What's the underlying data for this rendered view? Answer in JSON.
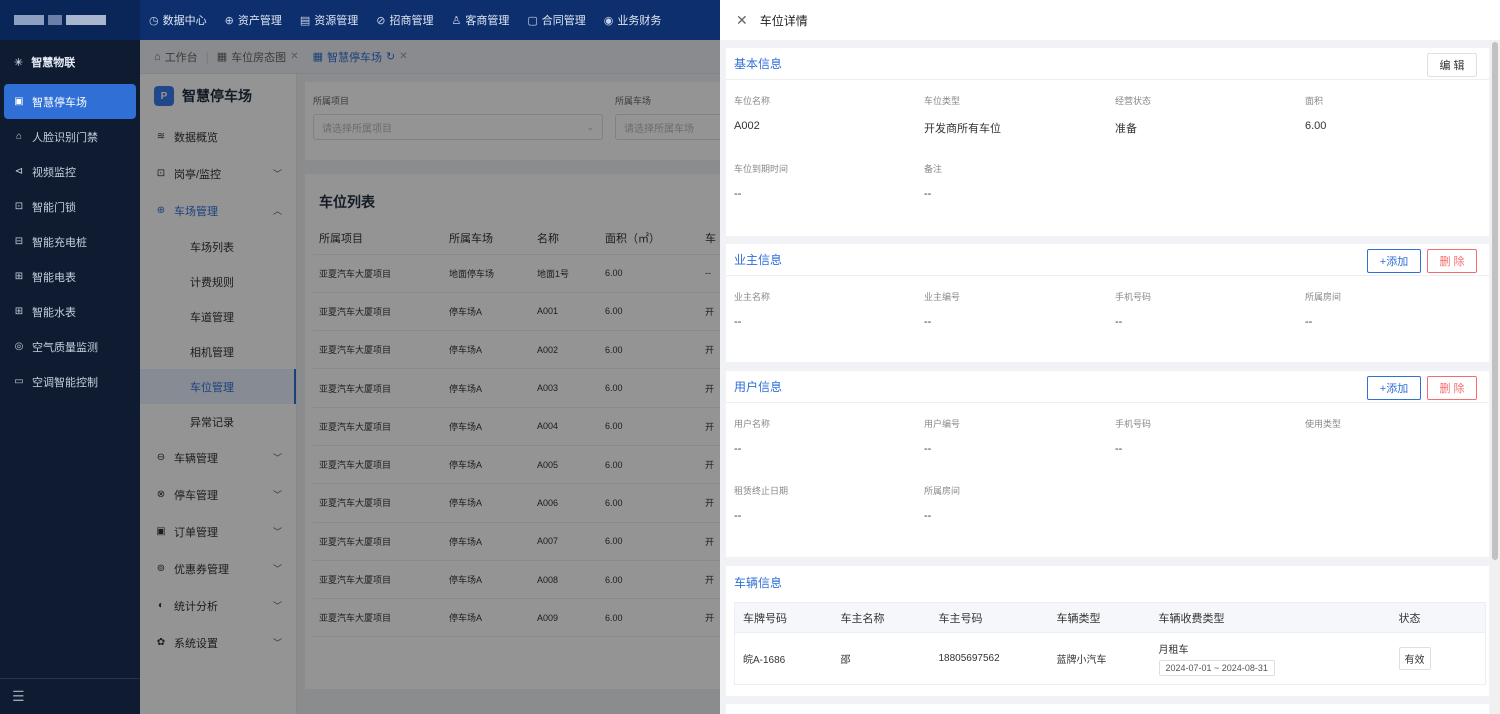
{
  "topnav": [
    {
      "icon": "◷",
      "label": "数据中心"
    },
    {
      "icon": "⊕",
      "label": "资产管理"
    },
    {
      "icon": "▤",
      "label": "资源管理"
    },
    {
      "icon": "⊘",
      "label": "招商管理"
    },
    {
      "icon": "♙",
      "label": "客商管理"
    },
    {
      "icon": "▢",
      "label": "合同管理"
    },
    {
      "icon": "◉",
      "label": "业务财务"
    }
  ],
  "sidebar": {
    "header": "智慧物联",
    "items": [
      {
        "label": "智慧停车场",
        "active": true
      },
      {
        "label": "人脸识别门禁"
      },
      {
        "label": "视频监控"
      },
      {
        "label": "智能门锁"
      },
      {
        "label": "智能充电桩"
      },
      {
        "label": "智能电表"
      },
      {
        "label": "智能水表"
      },
      {
        "label": "空气质量监测"
      },
      {
        "label": "空调智能控制"
      }
    ],
    "footer_icon": "☰"
  },
  "tabs": [
    {
      "label": "工作台"
    },
    {
      "label": "车位房态图"
    },
    {
      "label": "智慧停车场"
    }
  ],
  "submenu": {
    "title": "智慧停车场",
    "items": [
      {
        "label": "数据概览"
      },
      {
        "label": "岗亭/监控"
      },
      {
        "label": "车场管理"
      },
      {
        "label": "车辆管理"
      },
      {
        "label": "停车管理"
      },
      {
        "label": "订单管理"
      },
      {
        "label": "优惠券管理"
      },
      {
        "label": "统计分析"
      },
      {
        "label": "系统设置"
      }
    ],
    "subitems": [
      "车场列表",
      "计费规则",
      "车道管理",
      "相机管理",
      "车位管理",
      "异常记录"
    ]
  },
  "filters": {
    "project_label": "所属项目",
    "project_placeholder": "请选择所属项目",
    "lot_label": "所属车场",
    "lot_placeholder": "请选择所属车场"
  },
  "list": {
    "title": "车位列表",
    "columns": [
      "所属项目",
      "所属车场",
      "名称",
      "面积（㎡）",
      "车"
    ],
    "rows": [
      [
        "亚夏汽车大厦项目",
        "地面停车场",
        "地面1号",
        "6.00",
        "--"
      ],
      [
        "亚夏汽车大厦项目",
        "停车场A",
        "A001",
        "6.00",
        "开"
      ],
      [
        "亚夏汽车大厦项目",
        "停车场A",
        "A002",
        "6.00",
        "开"
      ],
      [
        "亚夏汽车大厦项目",
        "停车场A",
        "A003",
        "6.00",
        "开"
      ],
      [
        "亚夏汽车大厦项目",
        "停车场A",
        "A004",
        "6.00",
        "开"
      ],
      [
        "亚夏汽车大厦项目",
        "停车场A",
        "A005",
        "6.00",
        "开"
      ],
      [
        "亚夏汽车大厦项目",
        "停车场A",
        "A006",
        "6.00",
        "开"
      ],
      [
        "亚夏汽车大厦项目",
        "停车场A",
        "A007",
        "6.00",
        "开"
      ],
      [
        "亚夏汽车大厦项目",
        "停车场A",
        "A008",
        "6.00",
        "开"
      ],
      [
        "亚夏汽车大厦项目",
        "停车场A",
        "A009",
        "6.00",
        "开"
      ]
    ]
  },
  "drawer": {
    "title": "车位详情",
    "basic": {
      "title": "基本信息",
      "edit_label": "编 辑",
      "fields": [
        {
          "label": "车位名称",
          "value": "A002"
        },
        {
          "label": "车位类型",
          "value": "开发商所有车位"
        },
        {
          "label": "经营状态",
          "value": "准备"
        },
        {
          "label": "面积",
          "value": "6.00"
        },
        {
          "label": "车位到期时间",
          "value": "--"
        },
        {
          "label": "备注",
          "value": "--"
        }
      ]
    },
    "owner": {
      "title": "业主信息",
      "add_label": "+添加",
      "delete_label": "删 除",
      "fields": [
        {
          "label": "业主名称",
          "value": "--"
        },
        {
          "label": "业主编号",
          "value": "--"
        },
        {
          "label": "手机号码",
          "value": "--"
        },
        {
          "label": "所属房间",
          "value": "--"
        }
      ]
    },
    "user": {
      "title": "用户信息",
      "add_label": "+添加",
      "delete_label": "删 除",
      "fields": [
        {
          "label": "用户名称",
          "value": "--"
        },
        {
          "label": "用户编号",
          "value": "--"
        },
        {
          "label": "手机号码",
          "value": "--"
        },
        {
          "label": "使用类型",
          "value": ""
        },
        {
          "label": "租赁终止日期",
          "value": "--"
        },
        {
          "label": "所属房间",
          "value": "--"
        }
      ]
    },
    "vehicle": {
      "title": "车辆信息",
      "columns": [
        "车牌号码",
        "车主名称",
        "车主号码",
        "车辆类型",
        "车辆收费类型",
        "状态"
      ],
      "rows": [
        {
          "plate": "皖A-1686",
          "owner": "邵",
          "phone": "18805697562",
          "type": "蓝牌小汽车",
          "fee_type": "月租车",
          "period": "2024-07-01 ~ 2024-08-31",
          "status": "有效"
        }
      ]
    }
  }
}
